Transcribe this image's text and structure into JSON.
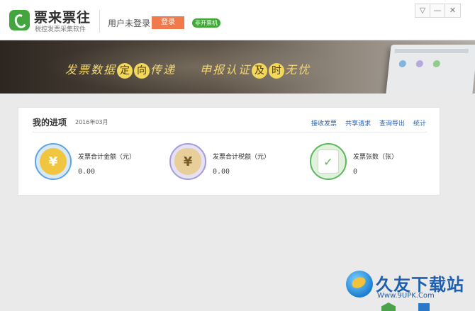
{
  "app": {
    "name": "票来票往",
    "subtitle": "税控发票采集软件"
  },
  "header": {
    "user_status": "用户未登录",
    "login_label": "登录",
    "mode_badge": "非开票机"
  },
  "window_controls": [
    {
      "label": "▽",
      "icon": "dropdown-icon"
    },
    {
      "label": "—",
      "icon": "minimize-icon"
    },
    {
      "label": "✕",
      "icon": "close-icon"
    }
  ],
  "banner": {
    "left_pre": "发票数据",
    "left_hl1": "定",
    "left_hl2": "向",
    "left_post": "传递",
    "right_pre": "申报认证",
    "right_hl1": "及",
    "right_hl2": "时",
    "right_post": "无忧"
  },
  "progress": {
    "title": "我的进项",
    "date": "2016年03月",
    "links": [
      "接收发票",
      "共享请求",
      "查询导出",
      "统计"
    ],
    "stats": [
      {
        "label": "发票合计金额（元）",
        "value": "0.00",
        "icon": "yuan-coin-icon",
        "color": "#5fa6de"
      },
      {
        "label": "发票合计税额（元）",
        "value": "0.00",
        "icon": "money-bag-icon",
        "color": "#a79bd8"
      },
      {
        "label": "发票张数（张）",
        "value": "0",
        "icon": "invoice-check-icon",
        "color": "#5cb85c"
      }
    ]
  },
  "watermark": {
    "title": "久友下载站",
    "url": "Www.9UPK.Com"
  }
}
